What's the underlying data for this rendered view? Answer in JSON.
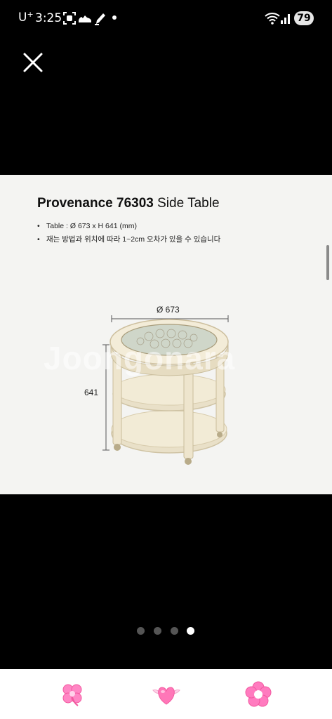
{
  "status_bar": {
    "carrier": "U",
    "carrier_sup": "+",
    "time": "3:25",
    "battery": "79",
    "icons": [
      "screen-record-icon",
      "sneaker-icon",
      "pen-icon",
      "wifi-icon",
      "signal-icon"
    ]
  },
  "viewer": {
    "close_icon": "close-icon",
    "product": {
      "title_model": "Provenance 76303",
      "title_rest": " Side Table",
      "specs": [
        "Table : Ø 673 x H 641 (mm)",
        "재는 방법과 위치에 따라 1~2cm 오차가 있을 수 있습니다"
      ],
      "dimension_diameter": "Ø 673",
      "dimension_height": "641",
      "watermark": "Joongonara"
    },
    "pager": {
      "total": 4,
      "active_index": 3
    }
  },
  "bottom_bar": {
    "icons": [
      "clover-icon",
      "winged-heart-icon",
      "flower-icon"
    ],
    "accent_color": "#ff7bbf"
  }
}
